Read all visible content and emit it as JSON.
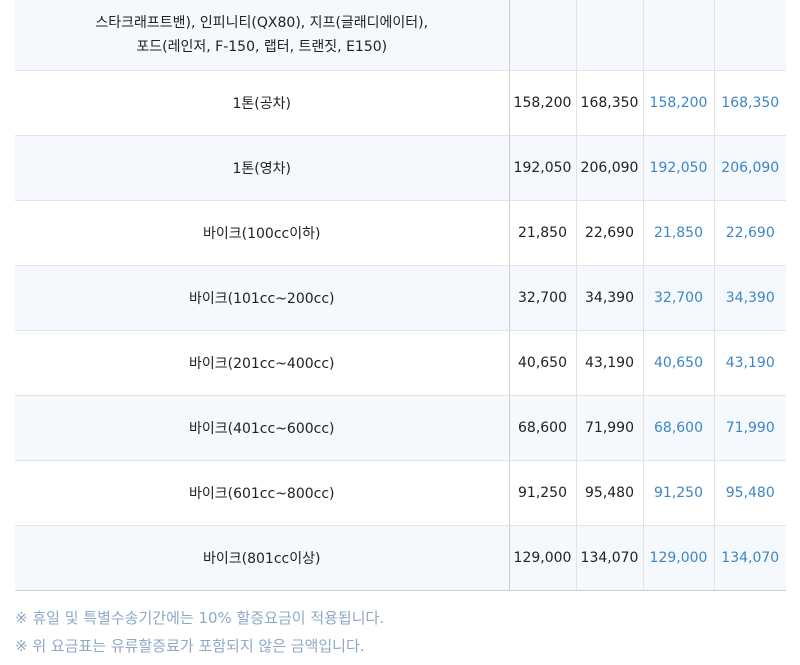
{
  "table": {
    "rows": [
      {
        "vehicle_lines": [
          "스타크래프트밴), 인피니티(QX80), 지프(글래디에이터),",
          "포드(레인저, F-150, 랩터, 트랜짓, E150)"
        ],
        "values": [
          "",
          "",
          "",
          ""
        ]
      },
      {
        "vehicle": "1톤(공차)",
        "values": [
          "158,200",
          "168,350",
          "158,200",
          "168,350"
        ]
      },
      {
        "vehicle": "1톤(영차)",
        "values": [
          "192,050",
          "206,090",
          "192,050",
          "206,090"
        ]
      },
      {
        "vehicle": "바이크(100cc이하)",
        "values": [
          "21,850",
          "22,690",
          "21,850",
          "22,690"
        ]
      },
      {
        "vehicle": "바이크(101cc~200cc)",
        "values": [
          "32,700",
          "34,390",
          "32,700",
          "34,390"
        ]
      },
      {
        "vehicle": "바이크(201cc~400cc)",
        "values": [
          "40,650",
          "43,190",
          "40,650",
          "43,190"
        ]
      },
      {
        "vehicle": "바이크(401cc~600cc)",
        "values": [
          "68,600",
          "71,990",
          "68,600",
          "71,990"
        ]
      },
      {
        "vehicle": "바이크(601cc~800cc)",
        "values": [
          "91,250",
          "95,480",
          "91,250",
          "95,480"
        ]
      },
      {
        "vehicle": "바이크(801cc이상)",
        "values": [
          "129,000",
          "134,070",
          "129,000",
          "134,070"
        ]
      }
    ]
  },
  "notes": [
    "※ 휴일 및 특별수송기간에는 10% 할증요금이 적용됩니다.",
    "※ 위 요금표는 유류할증료가 포함되지 않은 금액입니다."
  ],
  "colors": {
    "accent_value": "#3d86c6",
    "note_text": "#8fa8c8",
    "alt_row_bg": "#f5f8fc"
  }
}
